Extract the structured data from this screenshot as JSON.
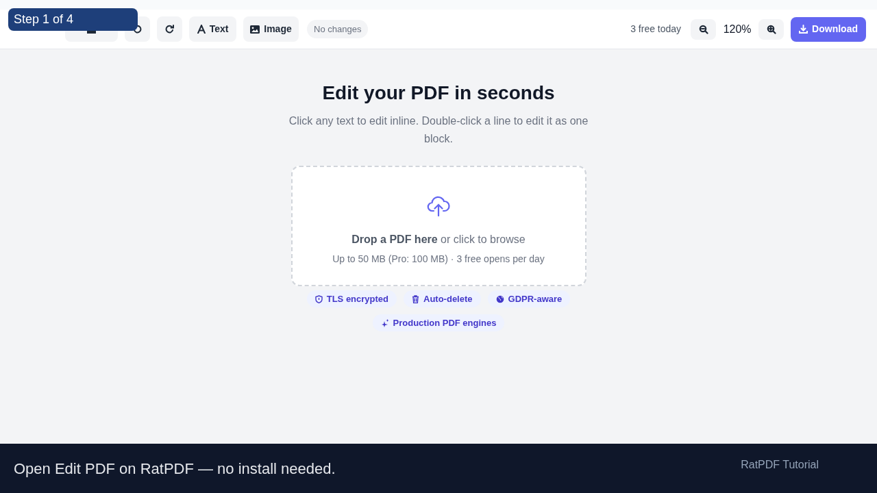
{
  "step_badge": "Step 1 of 4",
  "toolbar": {
    "buttons": [
      {
        "kind": "open"
      },
      {
        "kind": "undo"
      },
      {
        "kind": "redo"
      },
      {
        "kind": "text",
        "label": "Text"
      },
      {
        "kind": "image",
        "label": "Image"
      }
    ],
    "status": "No changes",
    "quota": "3 free today",
    "zoom": "120%",
    "download": "Download"
  },
  "hero": {
    "title": "Edit your PDF in seconds",
    "subtitle": "Click any text to edit inline. Double-click a line to edit it as one block."
  },
  "dropzone": {
    "headline": "**Drop a PDF here** or click to browse",
    "limits": "Up to 50 MB (Pro: 100 MB) · 3 free opens per day"
  },
  "badges": [
    {
      "kind": "shield",
      "label": "TLS encrypted"
    },
    {
      "kind": "trash",
      "label": "Auto-delete"
    },
    {
      "kind": "globe",
      "label": "GDPR-aware"
    },
    {
      "kind": "sparkle",
      "label": "Production PDF engines"
    }
  ],
  "footer": {
    "caption": "Open Edit PDF on RatPDF — no install needed.",
    "brand": "RatPDF Tutorial"
  }
}
